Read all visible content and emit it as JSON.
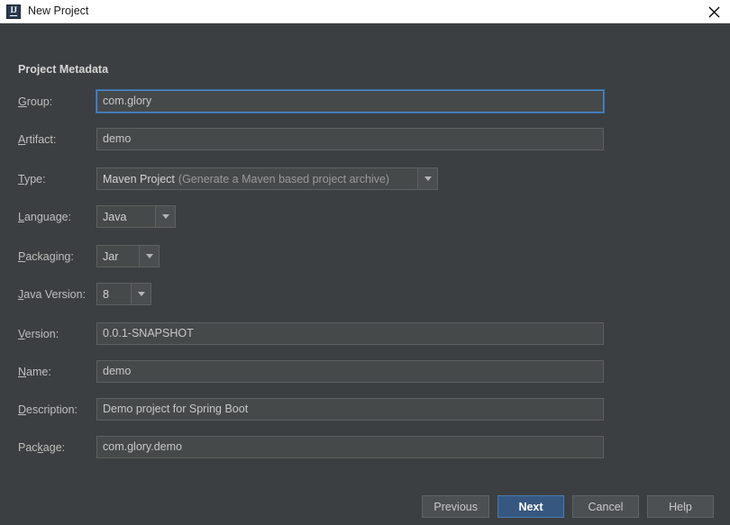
{
  "window": {
    "title": "New Project",
    "app_icon": "intellij-idea-icon",
    "close_icon": "close-icon"
  },
  "section": {
    "title": "Project Metadata"
  },
  "fields": {
    "group": {
      "label_pre": "",
      "label_mnemonic": "G",
      "label_post": "roup:",
      "value": "com.glory",
      "focused": true
    },
    "artifact": {
      "label_pre": "",
      "label_mnemonic": "A",
      "label_post": "rtifact:",
      "value": "demo",
      "focused": false
    },
    "type": {
      "label_pre": "",
      "label_mnemonic": "T",
      "label_post": "ype:",
      "value": "Maven Project",
      "value_dim": "(Generate a Maven based project archive)"
    },
    "language": {
      "label_pre": "",
      "label_mnemonic": "L",
      "label_post": "anguage:",
      "value": "Java"
    },
    "packaging": {
      "label_pre": "",
      "label_mnemonic": "P",
      "label_post": "ackaging:",
      "value": "Jar"
    },
    "java_version": {
      "label_pre": "",
      "label_mnemonic": "J",
      "label_post": "ava Version:",
      "value": "8"
    },
    "version": {
      "label_pre": "",
      "label_mnemonic": "V",
      "label_post": "ersion:",
      "value": "0.0.1-SNAPSHOT",
      "focused": false
    },
    "name": {
      "label_pre": "",
      "label_mnemonic": "N",
      "label_post": "ame:",
      "value": "demo",
      "focused": false
    },
    "description": {
      "label_pre": "",
      "label_mnemonic": "D",
      "label_post": "escription:",
      "value": "Demo project for Spring Boot",
      "focused": false
    },
    "package": {
      "label_pre": "Pac",
      "label_mnemonic": "k",
      "label_post": "age:",
      "value": "com.glory.demo",
      "focused": false
    }
  },
  "buttons": {
    "previous": "Previous",
    "next": "Next",
    "cancel": "Cancel",
    "help": "Help"
  },
  "colors": {
    "dialog_background": "#3c3f41",
    "field_background": "#45494a",
    "field_border": "#5e6060",
    "focus_border": "#4a88c7",
    "default_button_background": "#365880",
    "default_button_border": "#4a7ab0",
    "titlebar_background": "#ffffff",
    "text": "#bfbfbf"
  },
  "icons": {
    "dropdown_arrow": "chevron-down-icon"
  }
}
